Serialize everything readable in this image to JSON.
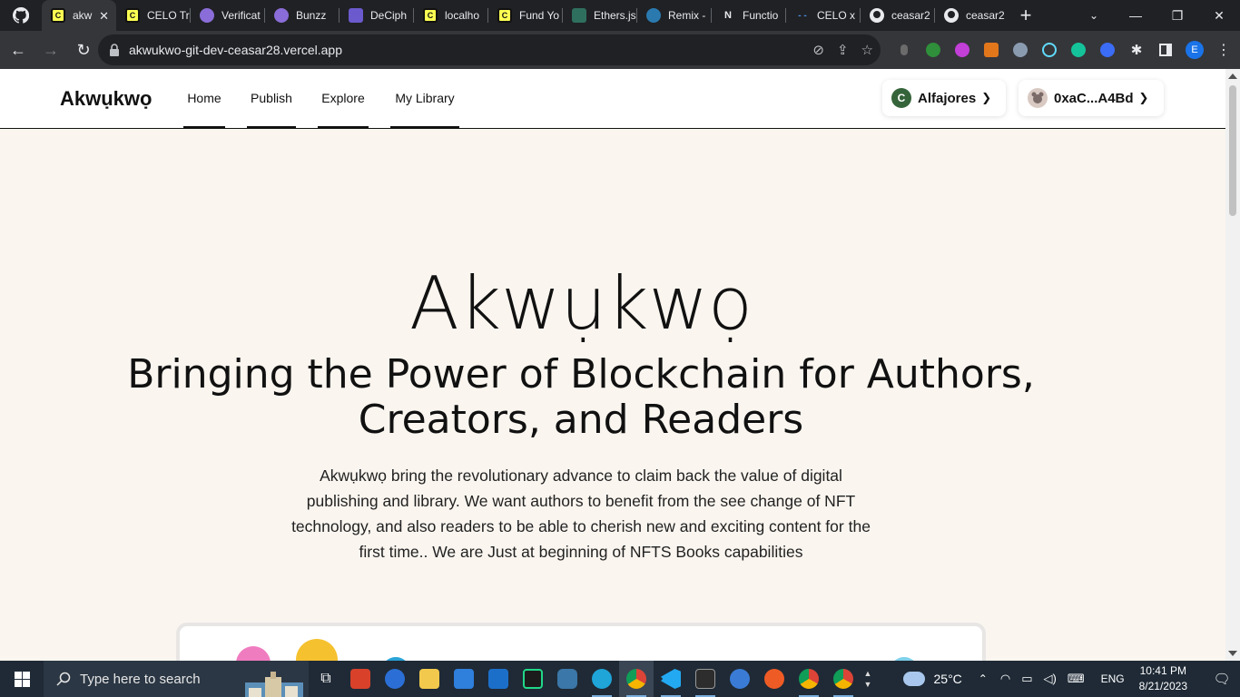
{
  "browser": {
    "tabs": [
      {
        "label": "akw",
        "favicon": "celo-icon",
        "active": true
      },
      {
        "label": "CELO Tr",
        "favicon": "celo-icon"
      },
      {
        "label": "Verificat",
        "favicon": "globe-purple-icon"
      },
      {
        "label": "Bunzz",
        "favicon": "globe-purple-icon"
      },
      {
        "label": "DeCiph",
        "favicon": "stack-icon"
      },
      {
        "label": "localho",
        "favicon": "celo-icon"
      },
      {
        "label": "Fund Yo",
        "favicon": "celo-icon"
      },
      {
        "label": "Ethers.js",
        "favicon": "ethers-icon"
      },
      {
        "label": "Remix -",
        "favicon": "remix-icon"
      },
      {
        "label": "Functio",
        "favicon": "n-icon"
      },
      {
        "label": "CELO x",
        "favicon": "dash-icon"
      },
      {
        "label": "ceasar2",
        "favicon": "github-icon"
      },
      {
        "label": "ceasar2",
        "favicon": "github-icon"
      }
    ],
    "url": "akwukwo-git-dev-ceasar28.vercel.app",
    "profile_initial": "E"
  },
  "site": {
    "brand": "Akwụkwọ",
    "nav": [
      "Home",
      "Publish",
      "Explore",
      "My Library"
    ],
    "network": "Alfajores",
    "network_icon_letter": "C",
    "account": "0xaC...A4Bd",
    "hero_title": "Akwụkwọ",
    "hero_subtitle": "Bringing the Power of Blockchain for Authors, Creators, and Readers",
    "hero_description": "Akwụkwọ bring the revolutionary advance to claim back the value of digital publishing and library. We want authors to benefit from the see change of NFT technology, and also readers to be able to cherish new and exciting content for the first time.. We are Just at beginning of NFTS Books capabilities"
  },
  "taskbar": {
    "search_placeholder": "Type here to search",
    "weather": "25°C",
    "language": "ENG",
    "time": "10:41 PM",
    "date": "8/21/2023"
  },
  "colors": {
    "page_bg": "#faf5ef",
    "celo_yellow": "#fcff52",
    "celo_green": "#35d07f",
    "taskbar": "#1f2a36"
  }
}
